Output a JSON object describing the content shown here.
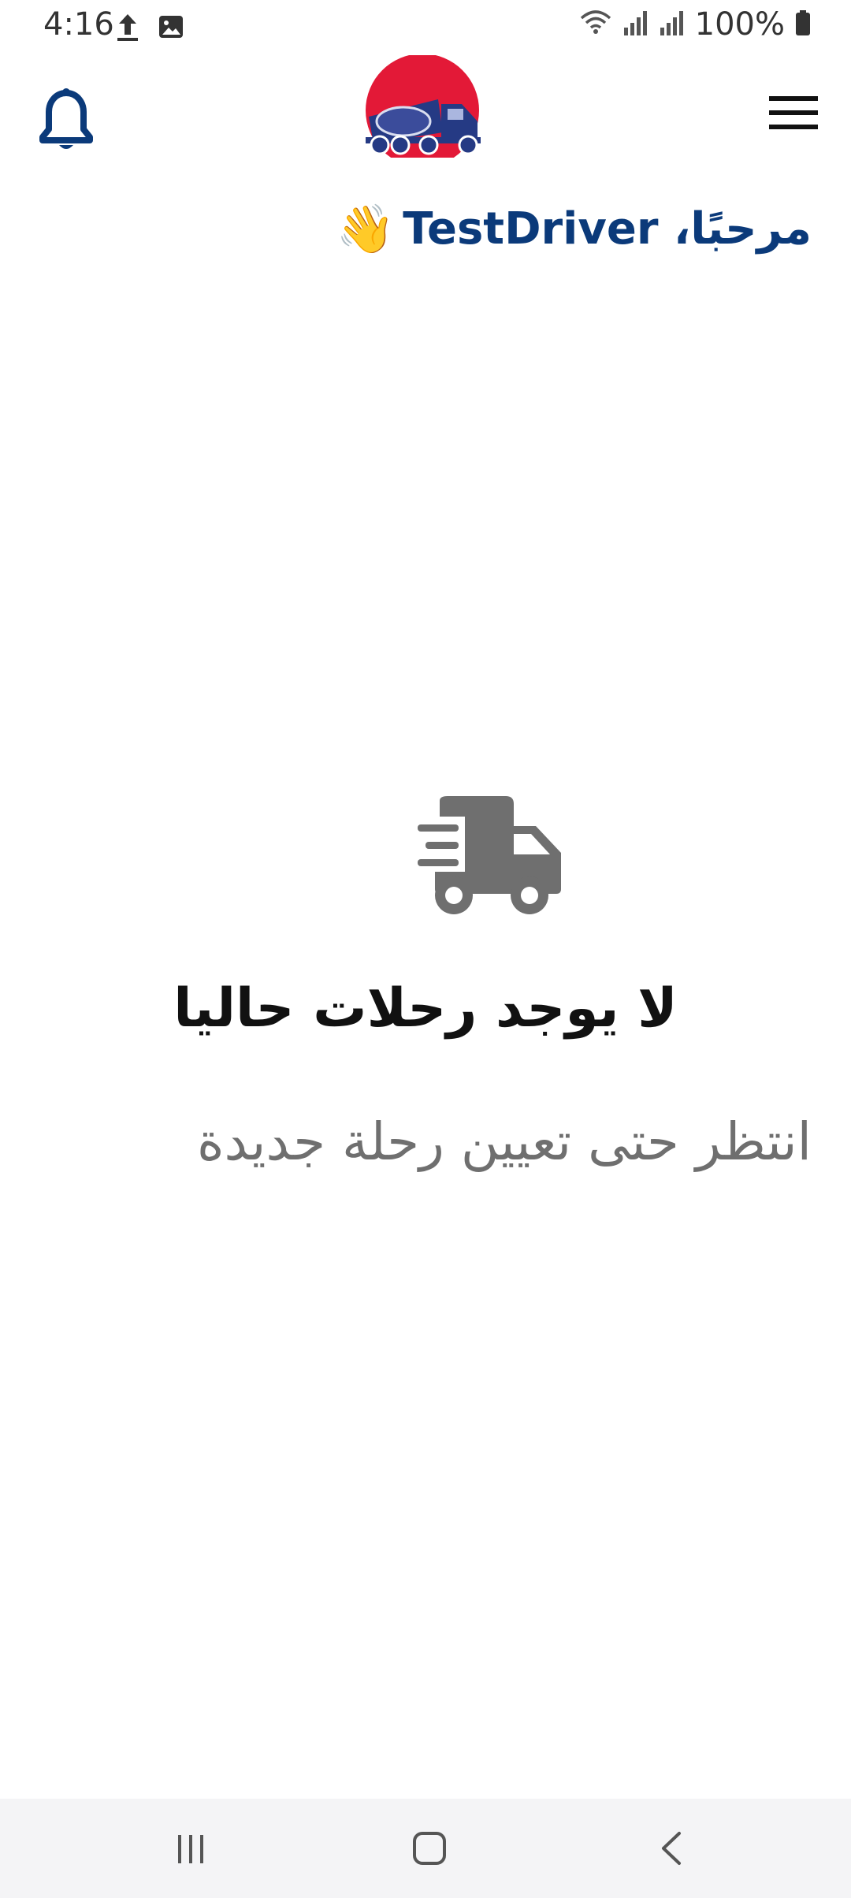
{
  "status_bar": {
    "time": "4:16",
    "battery": "100%",
    "icons": [
      "upload-icon",
      "image-icon",
      "wifi-icon",
      "signal-icon",
      "signal-icon",
      "battery-icon"
    ]
  },
  "header": {
    "notifications_icon": "bell-icon",
    "logo": "cement-mixer-truck-logo",
    "menu_icon": "hamburger-menu-icon"
  },
  "greeting": {
    "text": "مرحبًا، TestDriver",
    "emoji": "👋"
  },
  "empty_state": {
    "icon": "delivery-truck-icon",
    "title": "لا يوجد رحلات حاليا",
    "subtitle": "انتظر حتى تعيين رحلة جديدة"
  },
  "navigation_bar": {
    "recent_apps_icon": "recent-apps-icon",
    "home_icon": "home-icon",
    "back_icon": "back-icon"
  },
  "colors": {
    "brand_blue": "#0b3a7a",
    "brand_red": "#e31937",
    "icon_gray": "#6f6f6f",
    "nav_bg": "#f4f4f6"
  }
}
